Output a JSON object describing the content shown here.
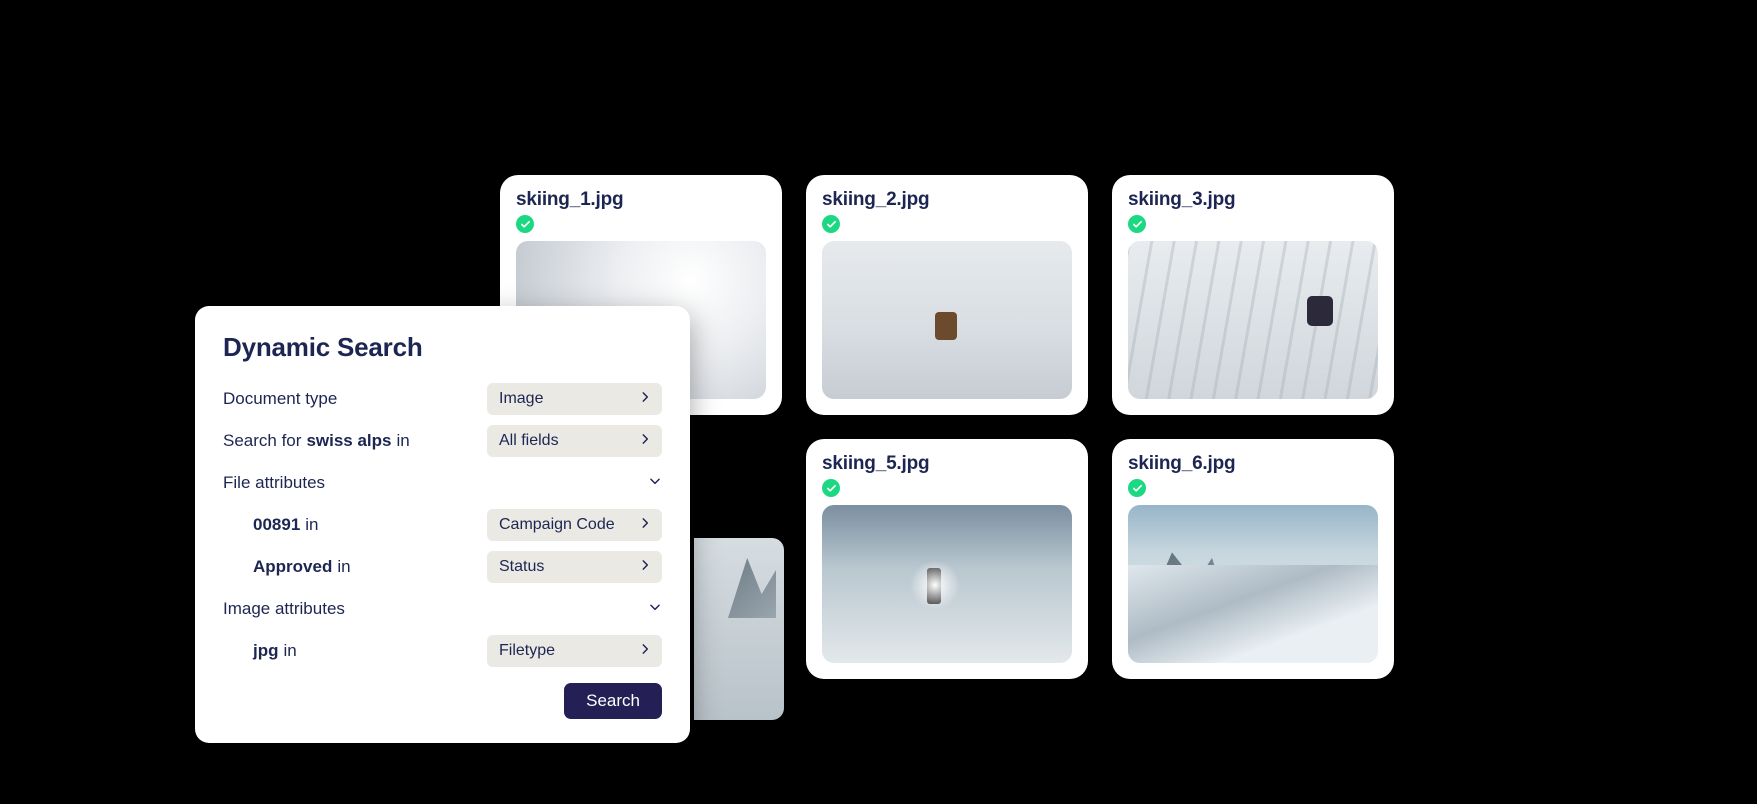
{
  "panel": {
    "title": "Dynamic Search",
    "doc_type_label": "Document type",
    "doc_type_value": "Image",
    "search_for_prefix": "Search for",
    "search_term": "swiss alps",
    "search_for_suffix": "in",
    "search_scope_value": "All fields",
    "file_attr_label": "File attributes",
    "attr1_value": "00891",
    "attr1_suffix": "in",
    "attr1_field": "Campaign Code",
    "attr2_value": "Approved",
    "attr2_suffix": "in",
    "attr2_field": "Status",
    "image_attr_label": "Image attributes",
    "attr3_value": "jpg",
    "attr3_suffix": "in",
    "attr3_field": "Filetype",
    "search_button": "Search"
  },
  "results": [
    {
      "filename": "skiing_1.jpg",
      "status": "approved",
      "img_class": "img1"
    },
    {
      "filename": "skiing_2.jpg",
      "status": "approved",
      "img_class": "img2"
    },
    {
      "filename": "skiing_3.jpg",
      "status": "approved",
      "img_class": "img3"
    },
    {
      "filename": "skiing_5.jpg",
      "status": "approved",
      "img_class": "img5"
    },
    {
      "filename": "skiing_6.jpg",
      "status": "approved",
      "img_class": "img6"
    }
  ]
}
